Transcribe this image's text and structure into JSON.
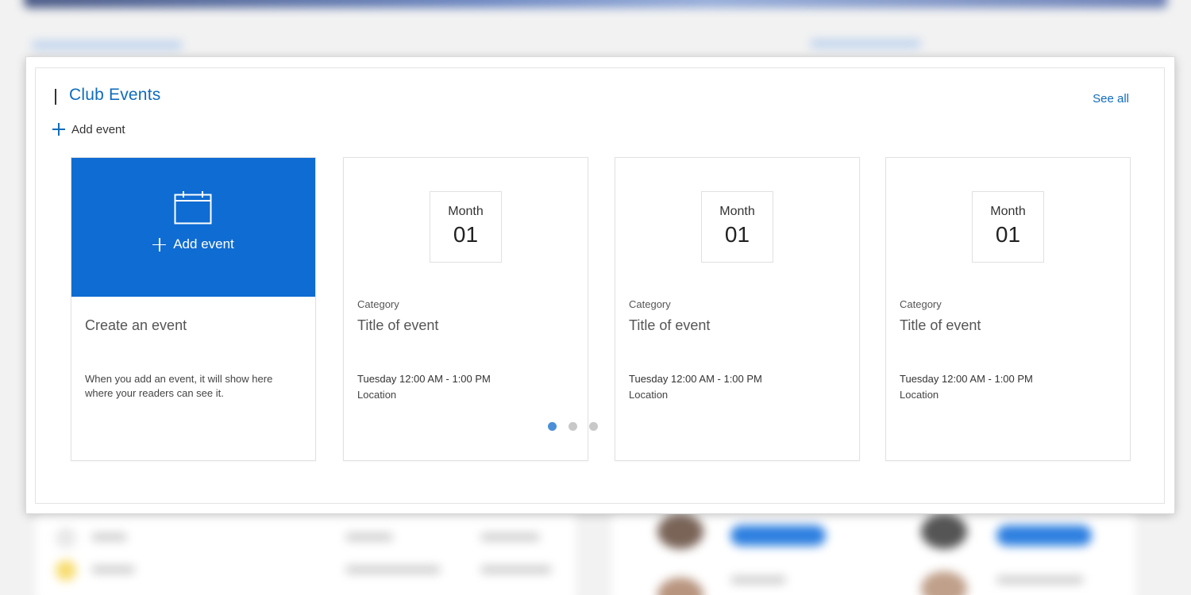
{
  "section": {
    "title": "Club Events",
    "see_all": "See all",
    "add_event": "Add event"
  },
  "create_card": {
    "button_label": "Add event",
    "heading": "Create an event",
    "description": "When you add an event, it will show here where your readers can see it."
  },
  "events": [
    {
      "month": "Month",
      "day": "01",
      "category": "Category",
      "title": "Title of event",
      "time": "Tuesday 12:00 AM - 1:00 PM",
      "location": "Location"
    },
    {
      "month": "Month",
      "day": "01",
      "category": "Category",
      "title": "Title of event",
      "time": "Tuesday 12:00 AM - 1:00 PM",
      "location": "Location"
    },
    {
      "month": "Month",
      "day": "01",
      "category": "Category",
      "title": "Title of event",
      "time": "Tuesday 12:00 AM - 1:00 PM",
      "location": "Location"
    }
  ],
  "pager": {
    "pages": 3,
    "active_page": 1
  },
  "colors": {
    "accent": "#0f6cbd",
    "create_tile": "#0f6cd2",
    "active_dot": "#4a8fd8"
  },
  "icons": {
    "add": "plus-icon",
    "calendar": "calendar-icon"
  }
}
